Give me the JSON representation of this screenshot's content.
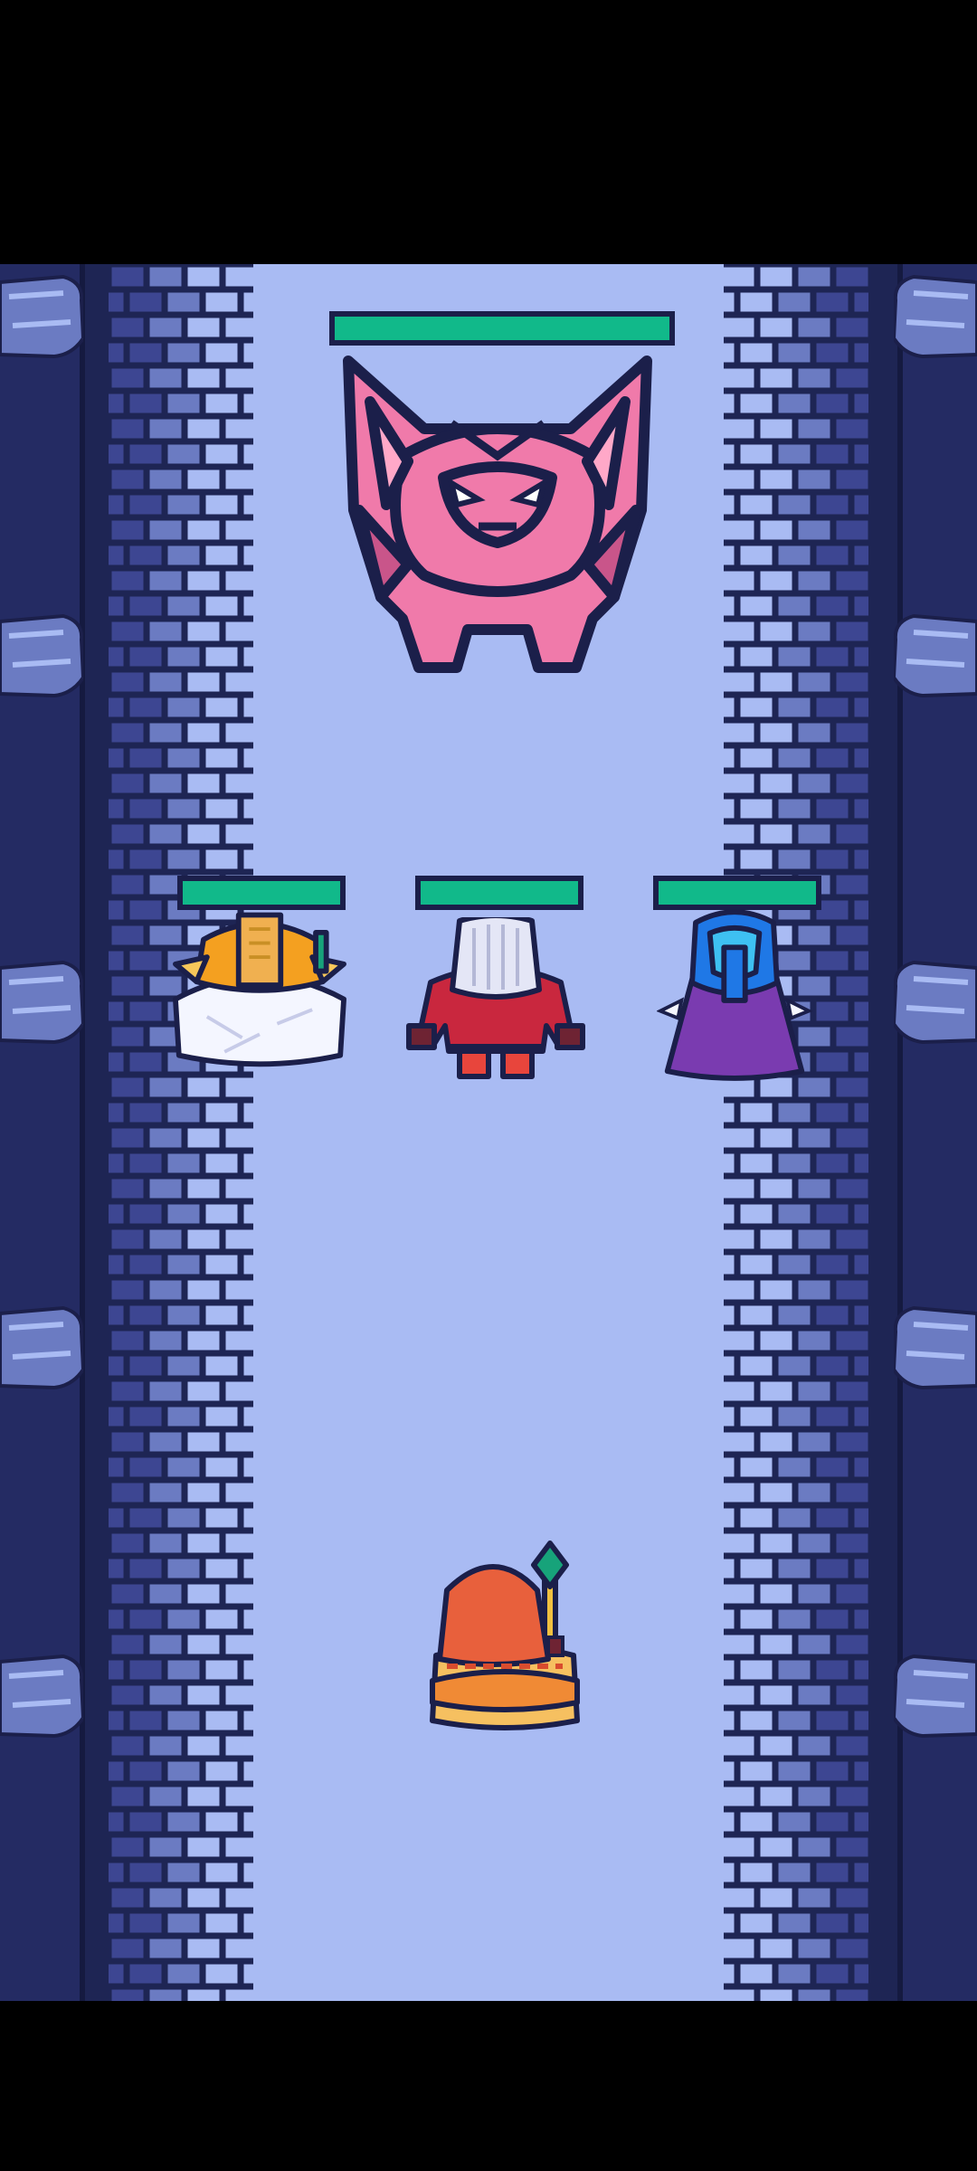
{
  "scene": "dungeon-corridor-battle",
  "colors": {
    "floor": "#a9bbf3",
    "wall_dark": "#242b63",
    "brick_mid": "#6b7bc2",
    "brick_light": "#a9bbf3",
    "hp_fill": "#11b98a",
    "outline": "#1b1f4a"
  },
  "boss": {
    "name_icon": "pink-horned-demon",
    "hp_fraction": 1.0
  },
  "party": [
    {
      "icon": "white-robed-monk",
      "hp_fraction": 1.0
    },
    {
      "icon": "white-haired-warrior",
      "hp_fraction": 1.0
    },
    {
      "icon": "purple-cloaked-mage",
      "hp_fraction": 1.0
    }
  ],
  "player": {
    "icon": "orange-hooded-wizard-with-staff"
  }
}
